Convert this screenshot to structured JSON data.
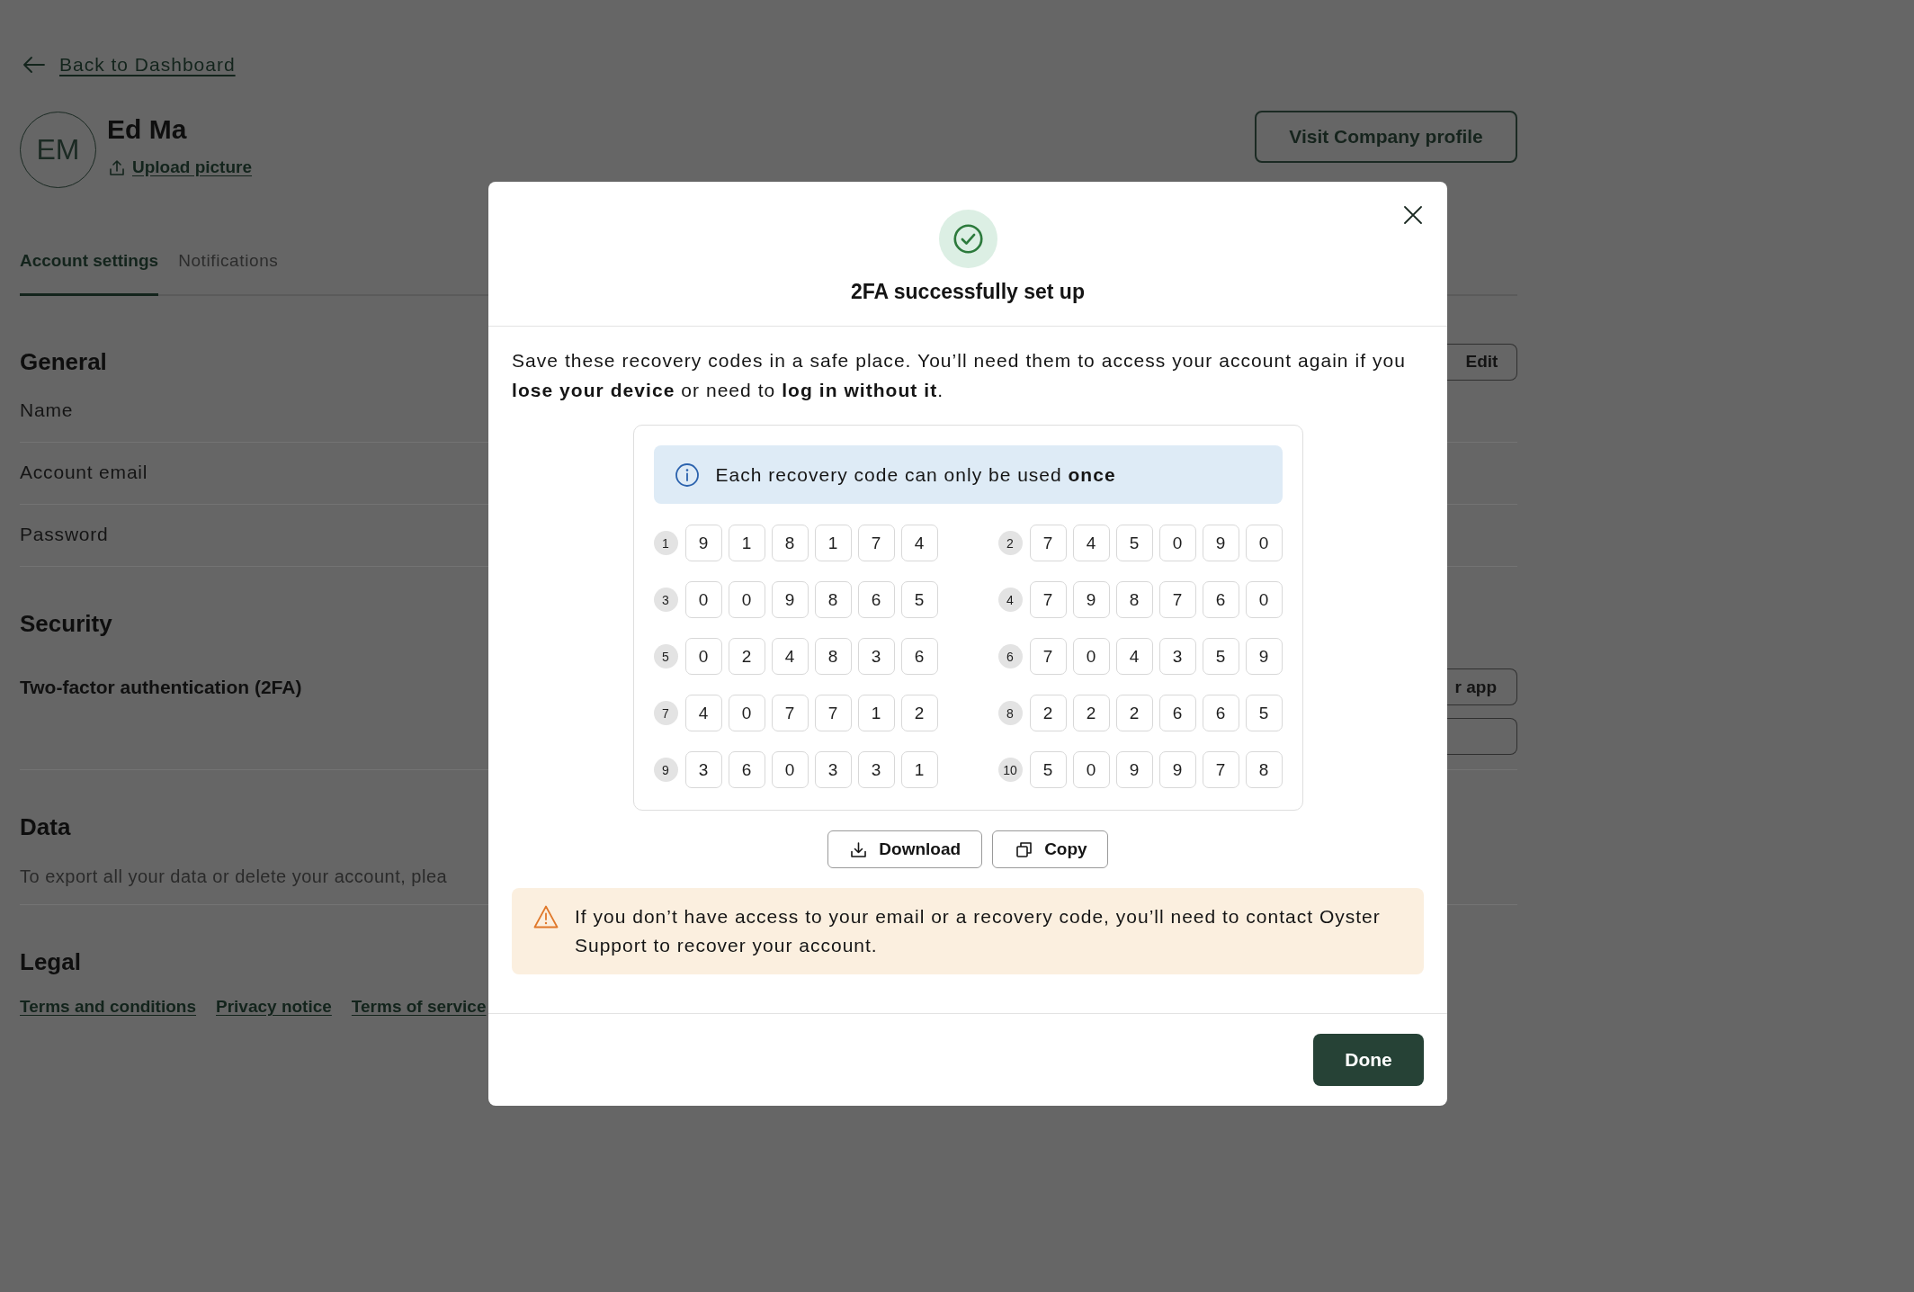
{
  "back_link": {
    "label": "Back to Dashboard"
  },
  "profile": {
    "initials": "EM",
    "name": "Ed Ma",
    "upload_link": "Upload picture",
    "company_button": "Visit Company profile"
  },
  "tabs": [
    {
      "label": "Account settings",
      "selected": true
    },
    {
      "label": "Notifications",
      "selected": false
    }
  ],
  "sections": [
    {
      "title": "General",
      "action": {
        "label": "Edit"
      },
      "rows": [
        {
          "kind": "field",
          "label": "Name"
        },
        {
          "kind": "field",
          "label": "Account email"
        },
        {
          "kind": "field",
          "label": "Password"
        }
      ]
    },
    {
      "title": "Security",
      "rows": [
        {
          "kind": "setting",
          "label": "Two-factor authentication (2FA)",
          "buttons": [
            {
              "kind": "labelled",
              "label": "r app"
            },
            {
              "kind": "blank"
            }
          ]
        }
      ]
    },
    {
      "title": "Data",
      "rows": [
        {
          "kind": "text",
          "text": "To export all your data or delete your account, plea"
        }
      ]
    },
    {
      "title": "Legal",
      "rows": [
        {
          "kind": "links",
          "links": [
            "Terms and conditions",
            "Privacy notice",
            "Terms of service"
          ]
        }
      ]
    }
  ],
  "dialog": {
    "title": "2FA successfully set up",
    "message": "Save these recovery codes in a safe place. You’ll need them to access your account again if you **lose your device** or need to **log in without it**.",
    "notice": "Each recovery code can only be used **once**",
    "codes": [
      {
        "number": "1",
        "digits": [
          "9",
          "1",
          "8",
          "1",
          "7",
          "4"
        ]
      },
      {
        "number": "2",
        "digits": [
          "7",
          "4",
          "5",
          "0",
          "9",
          "0"
        ]
      },
      {
        "number": "3",
        "digits": [
          "0",
          "0",
          "9",
          "8",
          "6",
          "5"
        ]
      },
      {
        "number": "4",
        "digits": [
          "7",
          "9",
          "8",
          "7",
          "6",
          "0"
        ]
      },
      {
        "number": "5",
        "digits": [
          "0",
          "2",
          "4",
          "8",
          "3",
          "6"
        ]
      },
      {
        "number": "6",
        "digits": [
          "7",
          "0",
          "4",
          "3",
          "5",
          "9"
        ]
      },
      {
        "number": "7",
        "digits": [
          "4",
          "0",
          "7",
          "7",
          "1",
          "2"
        ]
      },
      {
        "number": "8",
        "digits": [
          "2",
          "2",
          "2",
          "6",
          "6",
          "5"
        ]
      },
      {
        "number": "9",
        "digits": [
          "3",
          "6",
          "0",
          "3",
          "3",
          "1"
        ]
      },
      {
        "number": "10",
        "digits": [
          "5",
          "0",
          "9",
          "9",
          "7",
          "8"
        ]
      }
    ],
    "actions": [
      {
        "kind": "download",
        "label": "Download"
      },
      {
        "kind": "copy",
        "label": "Copy"
      }
    ],
    "warning": "If you don’t have access to your email or a recovery code, you’ll need to contact Oyster Support to recover your account.",
    "done_button": "Done"
  }
}
